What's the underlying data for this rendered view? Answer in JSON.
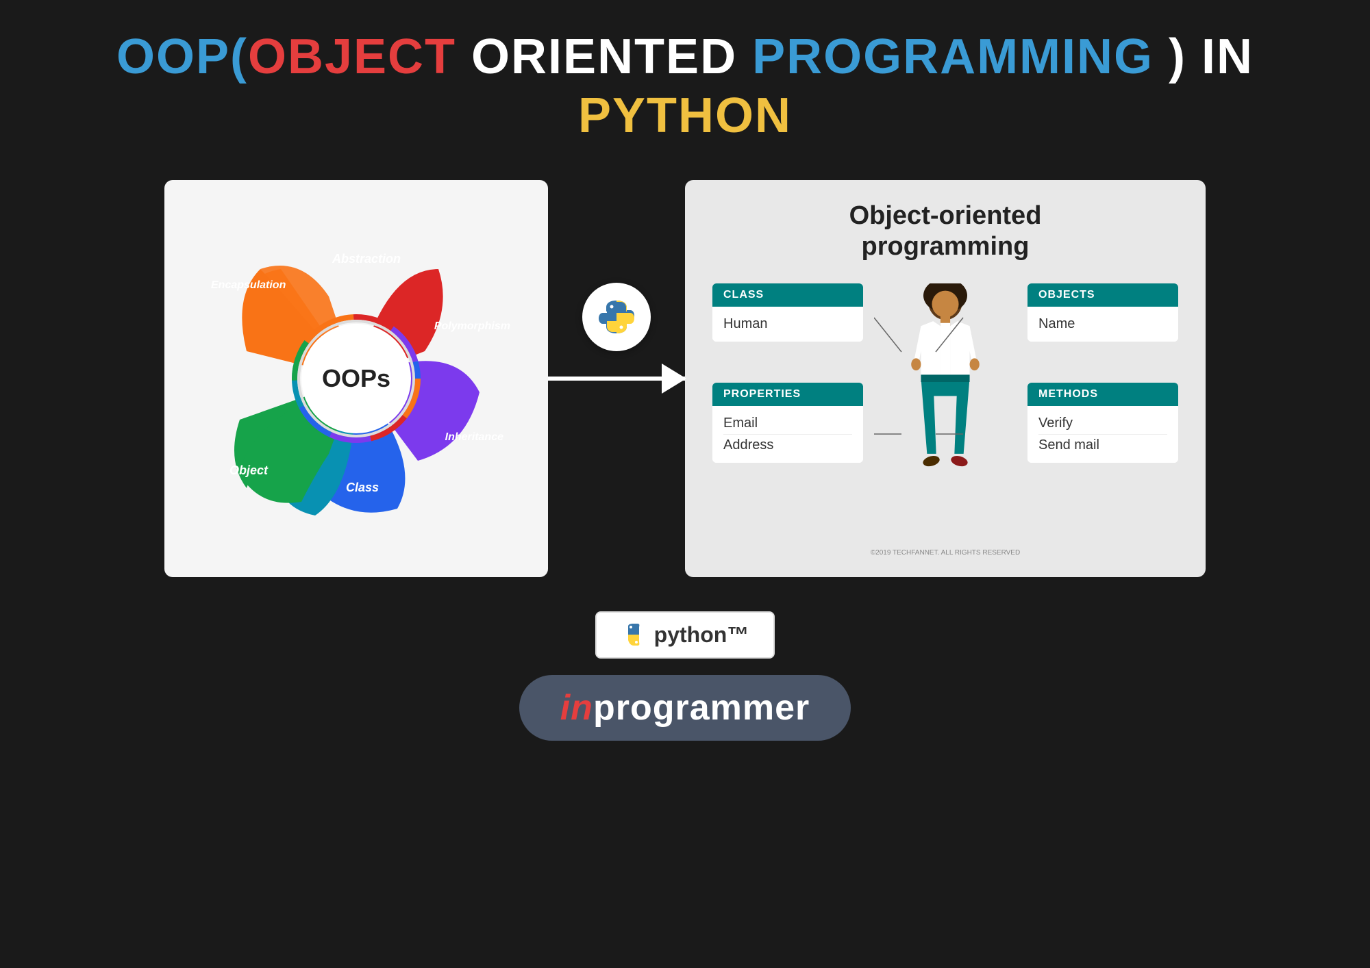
{
  "title": {
    "line1_parts": [
      {
        "text": "OOP(",
        "color": "t-blue"
      },
      {
        "text": "OBJECT",
        "color": "t-red"
      },
      {
        "text": " ORIENTED ",
        "color": "t-white"
      },
      {
        "text": "PROGRAMMING",
        "color": "t-blue"
      },
      {
        "text": " ) IN",
        "color": "t-white"
      }
    ],
    "line2_parts": [
      {
        "text": "PYTHON",
        "color": "t-yellow"
      }
    ]
  },
  "oops_diagram": {
    "center_text": "OOPs",
    "labels": {
      "encapsulation": "Encapsulation",
      "abstraction": "Abstraction",
      "polymorphism": "Polymorphism",
      "inheritance": "Inheritance",
      "class": "Class",
      "object": "Object"
    }
  },
  "oop_panel": {
    "title": "Object-oriented\nprogramming",
    "class_box": {
      "header": "CLASS",
      "items": [
        "Human"
      ]
    },
    "objects_box": {
      "header": "OBJECTS",
      "items": [
        "Name"
      ]
    },
    "properties_box": {
      "header": "PROPERTIES",
      "items": [
        "Email",
        "Address"
      ]
    },
    "methods_box": {
      "header": "METHODS",
      "items": [
        "Verify",
        "Send mail"
      ]
    },
    "copyright": "©2019 TECHFANNET. ALL RIGHTS RESERVED"
  },
  "python_badge": {
    "text": "python™"
  },
  "inprogrammer_badge": {
    "in_text": "in",
    "programmer_text": "programmer"
  },
  "colors": {
    "teal": "#008080",
    "orange": "#f97316",
    "red": "#dc2626",
    "purple": "#7c3aed",
    "blue": "#2563eb",
    "green": "#16a34a",
    "teal_dark": "#0d9488"
  }
}
